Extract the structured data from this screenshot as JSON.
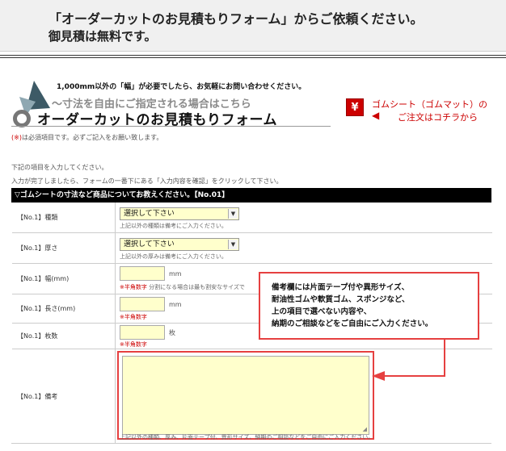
{
  "banner": {
    "line1": "「オーダーカットのお見積もりフォーム」からご依頼ください。",
    "line2": "御見積は無料です。"
  },
  "header": {
    "note": "1,000mm以外の「幅」が必要でしたら、お気軽にお問い合わせください。",
    "subtitle": "～寸法を自由にご指定される場合はこちら",
    "title": "オーダーカットのお見積もりフォーム",
    "rubber_link_line1": "ゴムシート（ゴムマット）の",
    "rubber_link_line2": "ご注文はコチラから",
    "yen_icon": "¥",
    "arrow_icon": "◀"
  },
  "required_note": {
    "mark": "(※)",
    "text": "は必須項目です。必ずご記入をお願い致します。"
  },
  "instructions": [
    "下記の項目を入力してください。",
    "入力が完了しましたら、フォームの一番下にある「入力内容を確認」をクリックして下さい。"
  ],
  "section": {
    "title": "▽ゴムシートの寸法など商品についてお教えください。【No.01】"
  },
  "form": {
    "kind": {
      "label": "【No.1】種類",
      "selected": "選択して下さい",
      "hint": "上記以外の種類は備考にご入力ください。"
    },
    "thickness": {
      "label": "【No.1】厚さ",
      "selected": "選択して下さい",
      "hint": "上記以外の厚みは備考にご入力ください。"
    },
    "width": {
      "label": "【No.1】幅(mm)",
      "unit": "mm",
      "hint_red": "※半角数字",
      "hint": "分割になる場合は最も割安なサイズで"
    },
    "length": {
      "label": "【No.1】長さ(mm)",
      "unit": "mm",
      "hint_red": "※半角数字"
    },
    "quantity": {
      "label": "【No.1】枚数",
      "unit": "枚",
      "hint_red": "※半角数字"
    },
    "remarks": {
      "label": "【No.1】備考",
      "hint": "上記以外の種類、厚み、片面テープ付、異形サイズ、納期のご相談などをご自由にご入力ください。"
    }
  },
  "callout": {
    "lines": [
      "備考欄には片面テープ付や異形サイズ、",
      "耐油性ゴムや軟質ゴム、スポンジなど、",
      "上の項目で選べない内容や、",
      "納期のご相談などをご自由にご入力ください。"
    ]
  },
  "colors": {
    "accent_red": "#e64040",
    "input_yellow": "#ffffcc",
    "header_black": "#000000"
  }
}
